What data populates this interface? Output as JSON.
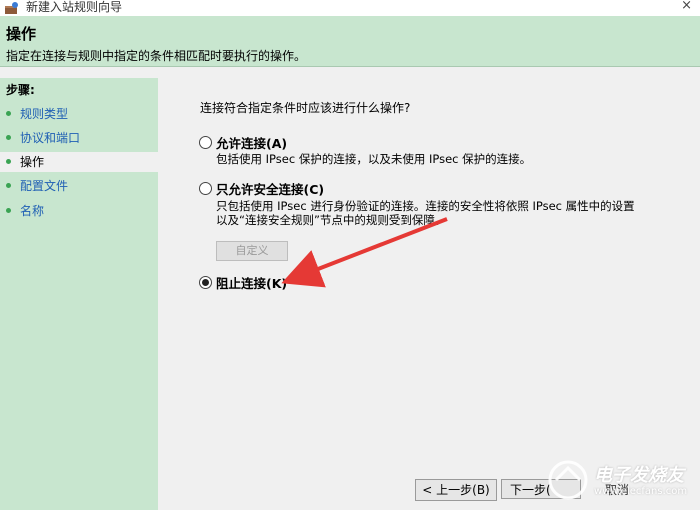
{
  "window": {
    "title": "新建入站规则向导",
    "close_glyph": "×"
  },
  "header": {
    "title": "操作",
    "description": "指定在连接与规则中指定的条件相匹配时要执行的操作。"
  },
  "sidebar": {
    "title": "步骤:",
    "items": [
      {
        "label": "规则类型"
      },
      {
        "label": "协议和端口"
      },
      {
        "label": "操作"
      },
      {
        "label": "配置文件"
      },
      {
        "label": "名称"
      }
    ]
  },
  "main": {
    "question": "连接符合指定条件时应该进行什么操作?",
    "options": [
      {
        "label": "允许连接(A)",
        "description": "包括使用 IPsec 保护的连接，以及未使用 IPsec 保护的连接。"
      },
      {
        "label": "只允许安全连接(C)",
        "description": "只包括使用 IPsec 进行身份验证的连接。连接的安全性将依照 IPsec 属性中的设置以及“连接安全规则”节点中的规则受到保障。"
      },
      {
        "label": "阻止连接(K)",
        "description": ""
      }
    ],
    "customize_label": "自定义"
  },
  "footer": {
    "back_label": "< 上一步(B)",
    "next_label": "下一步(",
    "cancel_label": "取消"
  },
  "watermark": {
    "text": "电子发烧友",
    "url": "www.elecfans.com"
  },
  "colors": {
    "header_bg": "#c8e6cf",
    "link": "#1f5fb4",
    "arrow": "#e53935"
  }
}
